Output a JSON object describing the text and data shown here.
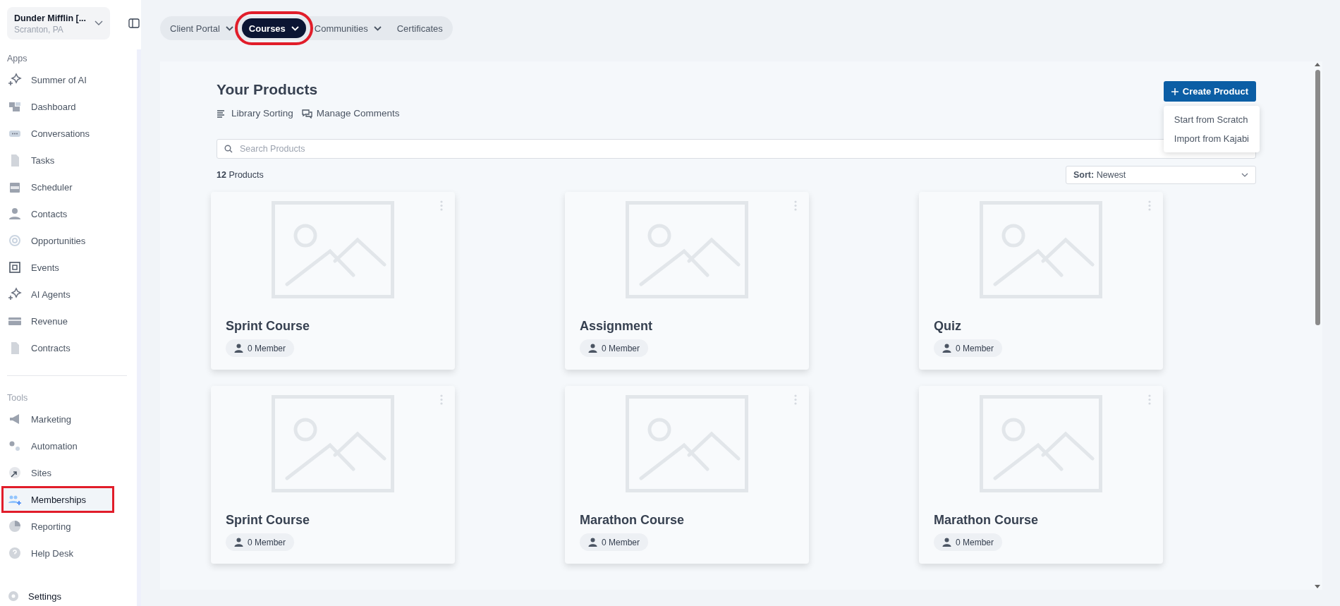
{
  "org": {
    "name": "Dunder Mifflin [...",
    "location": "Scranton, PA"
  },
  "sidebar": {
    "sections": [
      {
        "title": "Apps",
        "items": [
          {
            "label": "Summer of AI",
            "selected": false
          },
          {
            "label": "Dashboard",
            "selected": false
          },
          {
            "label": "Conversations",
            "selected": false
          },
          {
            "label": "Tasks",
            "selected": false
          },
          {
            "label": "Scheduler",
            "selected": false
          },
          {
            "label": "Contacts",
            "selected": false
          },
          {
            "label": "Opportunities",
            "selected": false
          },
          {
            "label": "Events",
            "selected": false
          },
          {
            "label": "AI Agents",
            "selected": false
          },
          {
            "label": "Revenue",
            "selected": false
          },
          {
            "label": "Contracts",
            "selected": false
          }
        ]
      },
      {
        "title": "Tools",
        "items": [
          {
            "label": "Marketing",
            "selected": false,
            "highlighted": false
          },
          {
            "label": "Automation",
            "selected": false,
            "highlighted": false
          },
          {
            "label": "Sites",
            "selected": false,
            "highlighted": false
          },
          {
            "label": "Memberships",
            "selected": true,
            "highlighted": true
          },
          {
            "label": "Reporting",
            "selected": false,
            "highlighted": false
          },
          {
            "label": "Help Desk",
            "selected": false,
            "highlighted": false
          }
        ]
      }
    ],
    "settings": "Settings"
  },
  "nav_tabs": [
    {
      "label": "Client Portal",
      "has_menu": true,
      "selected": false,
      "highlighted": false
    },
    {
      "label": "Courses",
      "has_menu": true,
      "selected": true,
      "highlighted": true
    },
    {
      "label": "Communities",
      "has_menu": true,
      "selected": false,
      "highlighted": false
    },
    {
      "label": "Certificates",
      "has_menu": false,
      "selected": false,
      "highlighted": false
    }
  ],
  "products": {
    "title": "Your Products",
    "actions": [
      "Library Sorting",
      "Manage Comments"
    ],
    "create_button": "Create Product",
    "create_menu": [
      "Start from Scratch",
      "Import from Kajabi"
    ],
    "search": {
      "placeholder": "Search Products"
    },
    "count": "**12** Products",
    "sort": {
      "label": "Sort:",
      "value": "Newest"
    },
    "cards": [
      {
        "title": "Sprint Course",
        "members": "0 Member"
      },
      {
        "title": "Assignment",
        "members": "0 Member"
      },
      {
        "title": "Quiz",
        "members": "0 Member"
      },
      {
        "title": "Sprint Course",
        "members": "0 Member"
      },
      {
        "title": "Marathon Course",
        "members": "0 Member"
      },
      {
        "title": "Marathon Course",
        "members": "0 Member"
      }
    ]
  }
}
